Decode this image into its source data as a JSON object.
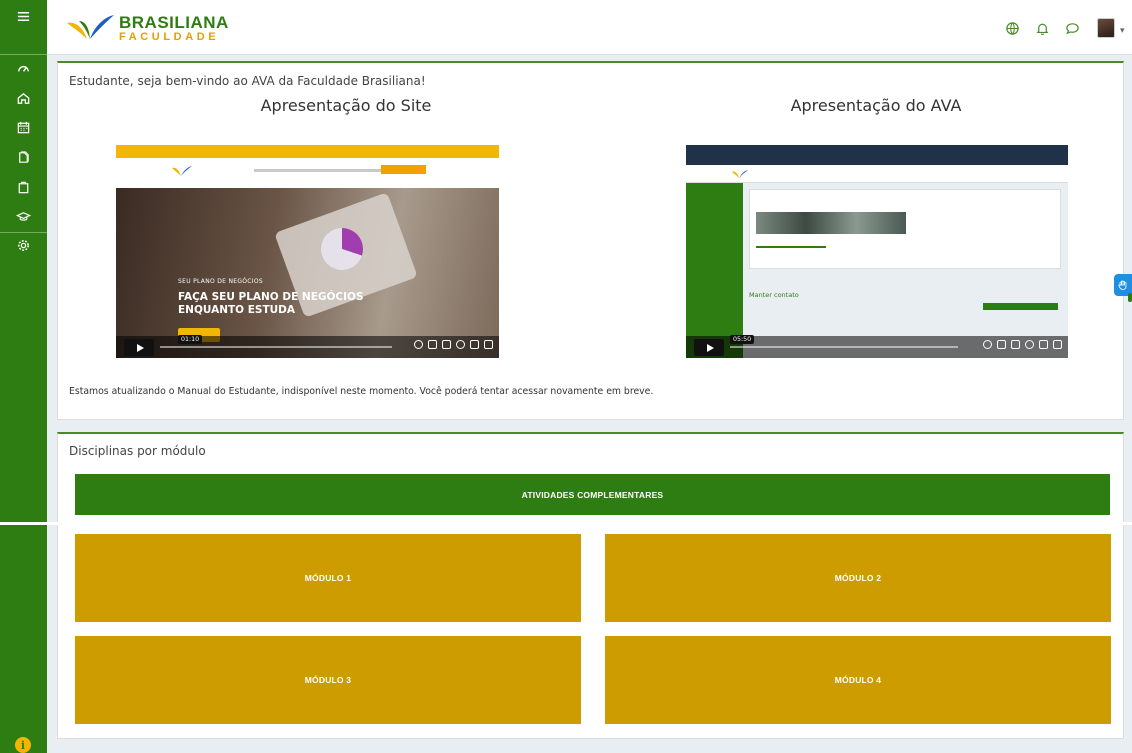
{
  "brand": {
    "name_line1": "BRASILIANA",
    "name_line2": "FACULDADE"
  },
  "colors": {
    "primary_green": "#2e7d12",
    "module_gold": "#cc9c00",
    "accent_yellow": "#f2b705",
    "accessibility_blue": "#1f8fe0"
  },
  "sidebar": {
    "items": [
      {
        "icon": "menu-icon"
      },
      {
        "icon": "dashboard-icon"
      },
      {
        "icon": "home-icon"
      },
      {
        "icon": "calendar-icon"
      },
      {
        "icon": "files-icon"
      },
      {
        "icon": "clipboard-icon"
      },
      {
        "icon": "graduation-cap-icon"
      },
      {
        "icon": "settings-icon"
      },
      {
        "icon": "info-icon"
      }
    ]
  },
  "topbar": {
    "icons": [
      "globe-icon",
      "bell-icon",
      "chat-icon",
      "user-avatar"
    ]
  },
  "main": {
    "welcome": "Estudante, seja bem-vindo ao AVA da Faculdade Brasiliana!",
    "video_site": {
      "title": "Apresentação do Site",
      "hero_small": "SEU PLANO DE NEGÓCIOS",
      "hero_big": "FAÇA SEU PLANO DE NEGÓCIOS ENQUANTO ESTUDA",
      "time": "01:10",
      "progress": 0.12
    },
    "video_ava": {
      "title": "Apresentação do AVA",
      "contact": "Manter contato",
      "time": "05:50",
      "progress": 0.02
    },
    "manual_message": "Estamos atualizando o Manual do Estudante, indisponível neste momento. Você poderá tentar acessar novamente em breve."
  },
  "modules": {
    "heading": "Disciplinas por módulo",
    "atividades": "ATIVIDADES COMPLEMENTARES",
    "items": [
      "MÓDULO 1",
      "MÓDULO 2",
      "MÓDULO 3",
      "MÓDULO 4"
    ]
  }
}
